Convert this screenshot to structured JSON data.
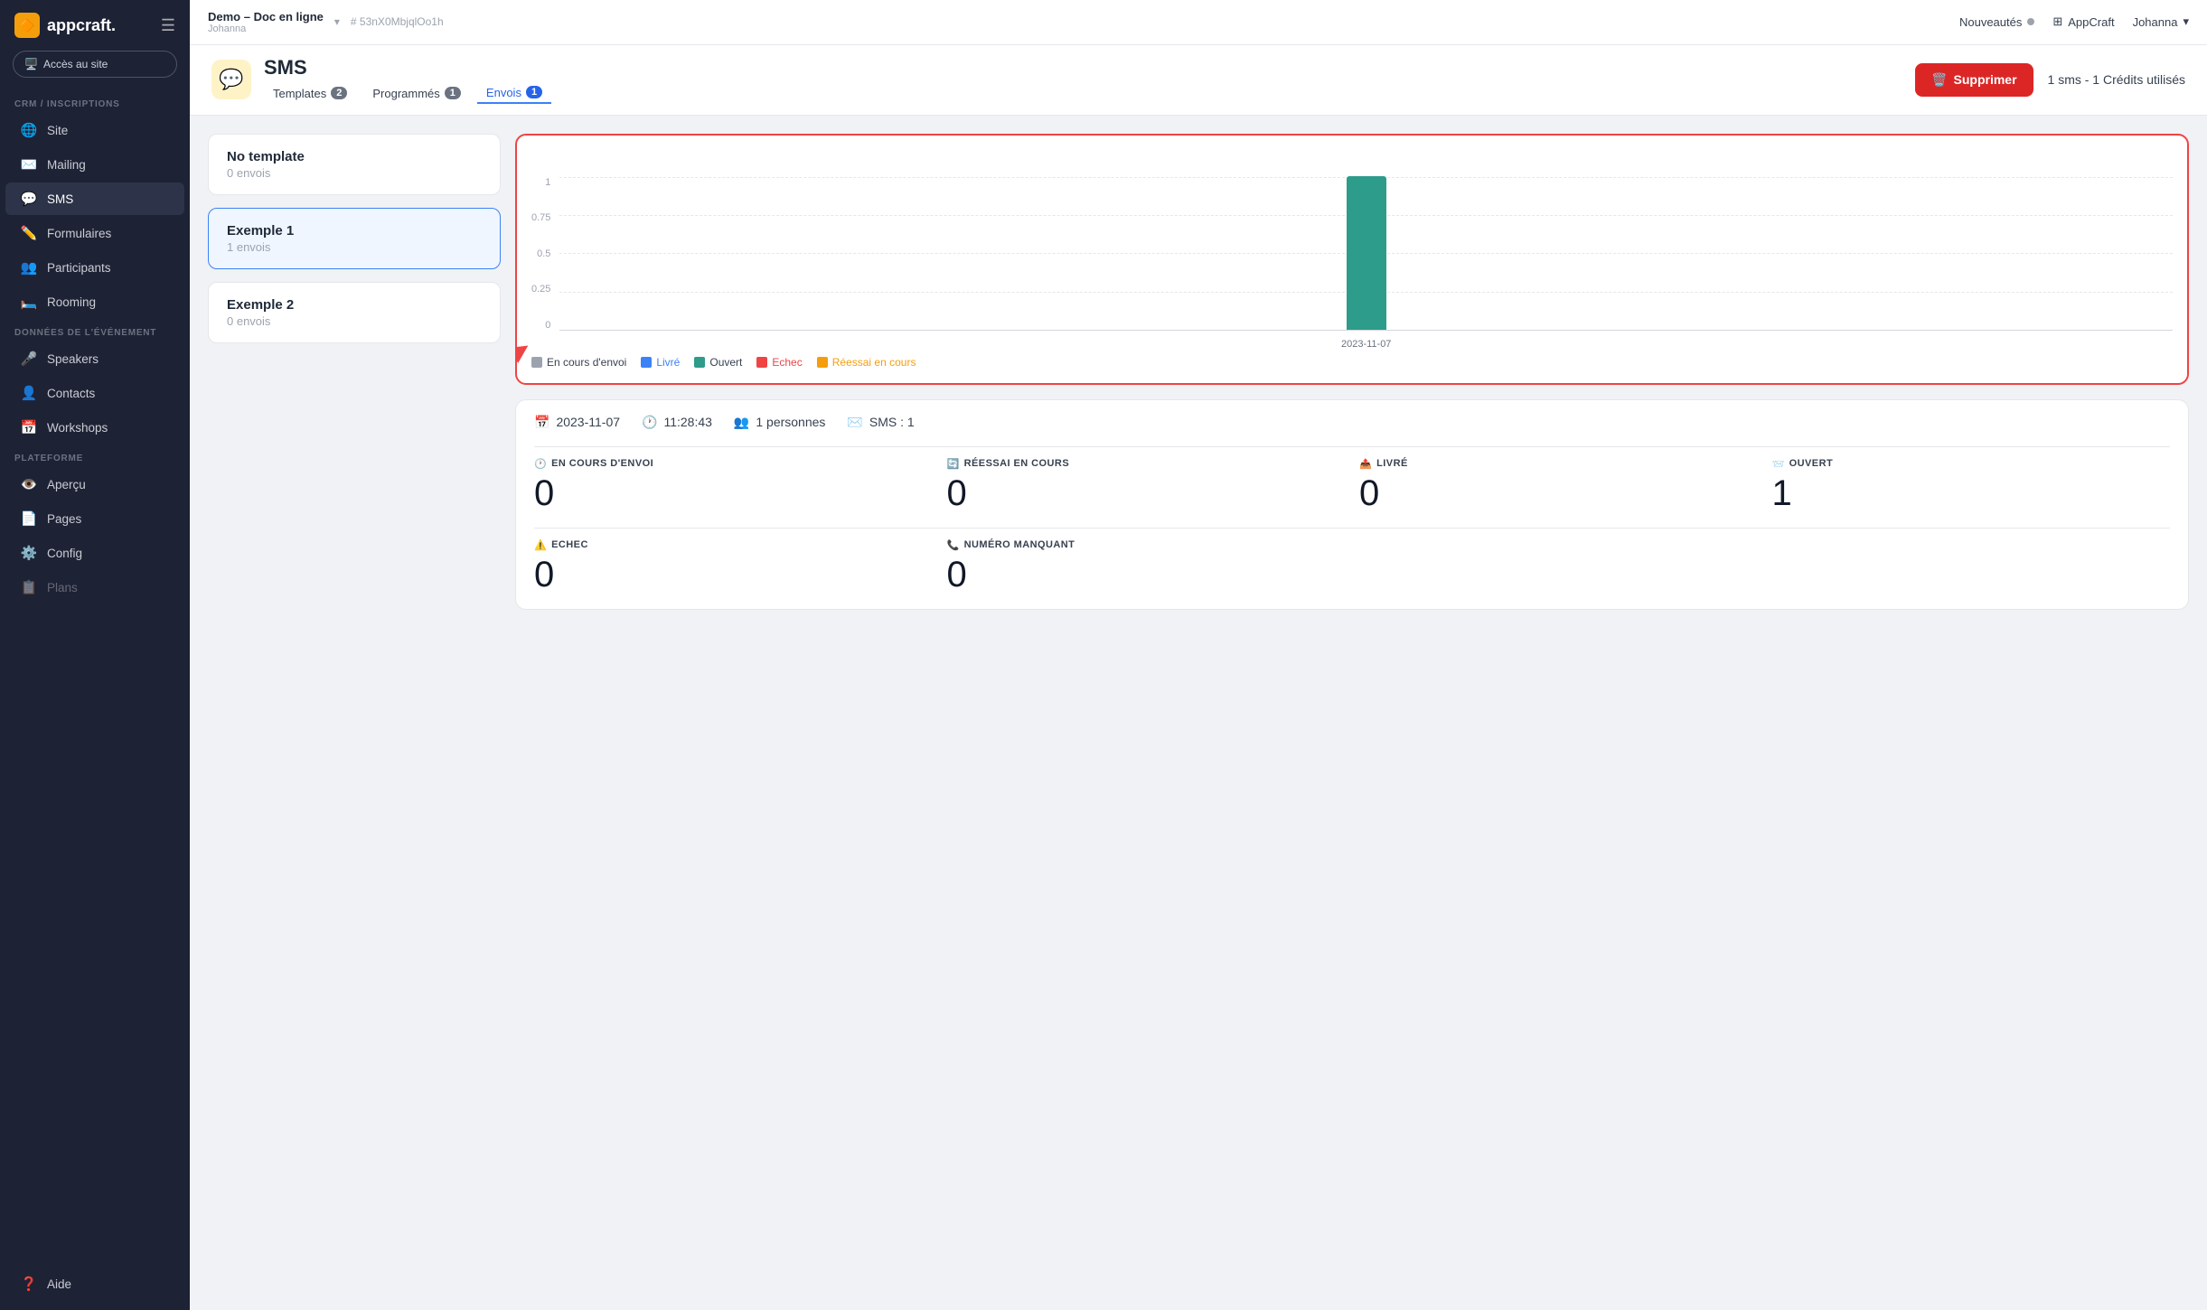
{
  "sidebar": {
    "logo": "appcraft.",
    "logo_icon": "🔶",
    "access_btn": "Accès au site",
    "crm_label": "CRM / INSCRIPTIONS",
    "crm_items": [
      {
        "id": "site",
        "icon": "🌐",
        "label": "Site"
      },
      {
        "id": "mailing",
        "icon": "✉️",
        "label": "Mailing"
      },
      {
        "id": "sms",
        "icon": "💬",
        "label": "SMS",
        "active": true
      },
      {
        "id": "formulaires",
        "icon": "✏️",
        "label": "Formulaires"
      },
      {
        "id": "participants",
        "icon": "👥",
        "label": "Participants"
      },
      {
        "id": "rooming",
        "icon": "🛏️",
        "label": "Rooming"
      }
    ],
    "donnees_label": "DONNÉES DE L'ÉVÉNEMENT",
    "donnees_items": [
      {
        "id": "speakers",
        "icon": "🎤",
        "label": "Speakers"
      },
      {
        "id": "contacts",
        "icon": "👤",
        "label": "Contacts"
      },
      {
        "id": "workshops",
        "icon": "📅",
        "label": "Workshops"
      }
    ],
    "plateforme_label": "PLATEFORME",
    "plateforme_items": [
      {
        "id": "apercu",
        "icon": "👁️",
        "label": "Aperçu"
      },
      {
        "id": "pages",
        "icon": "📄",
        "label": "Pages"
      },
      {
        "id": "config",
        "icon": "⚙️",
        "label": "Config"
      },
      {
        "id": "plans",
        "icon": "📋",
        "label": "Plans"
      }
    ],
    "aide": "Aide"
  },
  "topbar": {
    "project_name": "Demo – Doc en ligne",
    "project_sub": "Johanna",
    "hash": "# 53nX0MbjqlOo1h",
    "nouveautes": "Nouveautés",
    "appcraft": "AppCraft",
    "user": "Johanna"
  },
  "sms": {
    "icon": "💬",
    "title": "SMS",
    "tabs": [
      {
        "id": "templates",
        "label": "Templates",
        "badge": "2",
        "badge_color": "gray"
      },
      {
        "id": "programmes",
        "label": "Programmés",
        "badge": "1",
        "badge_color": "gray"
      },
      {
        "id": "envois",
        "label": "Envois",
        "badge": "1",
        "badge_color": "blue",
        "active": true
      }
    ],
    "supprimer_btn": "Supprimer",
    "credits": "1 sms - 1 Crédits utilisés"
  },
  "templates": [
    {
      "id": "no-template",
      "title": "No template",
      "sub": "0 envois",
      "selected": false
    },
    {
      "id": "exemple1",
      "title": "Exemple 1",
      "sub": "1 envois",
      "selected": true
    },
    {
      "id": "exemple2",
      "title": "Exemple 2",
      "sub": "0 envois",
      "selected": false
    }
  ],
  "chart": {
    "y_labels": [
      "1",
      "0.75",
      "0.5",
      "0.25",
      "0"
    ],
    "x_label": "2023-11-07",
    "bar_height_pct": 100,
    "bar_color": "#2d9c8a",
    "legend": [
      {
        "label": "En cours d'envoi",
        "color": "#9ca3af"
      },
      {
        "label": "Livré",
        "color": "#3b82f6"
      },
      {
        "label": "Ouvert",
        "color": "#2d9c8a"
      },
      {
        "label": "Echec",
        "color": "#ef4444"
      },
      {
        "label": "Réessai en cours",
        "color": "#f59e0b"
      }
    ]
  },
  "stats": {
    "date": "2023-11-07",
    "time": "11:28:43",
    "personnes": "1 personnes",
    "sms": "SMS : 1",
    "en_cours_label": "EN COURS D'ENVOI",
    "en_cours_value": "0",
    "reessai_label": "RÉESSAI EN COURS",
    "reessai_value": "0",
    "livre_label": "LIVRÉ",
    "livre_value": "0",
    "ouvert_label": "OUVERT",
    "ouvert_value": "1",
    "echec_label": "ECHEC",
    "echec_value": "0",
    "numero_label": "NUMÉRO MANQUANT",
    "numero_value": "0"
  }
}
